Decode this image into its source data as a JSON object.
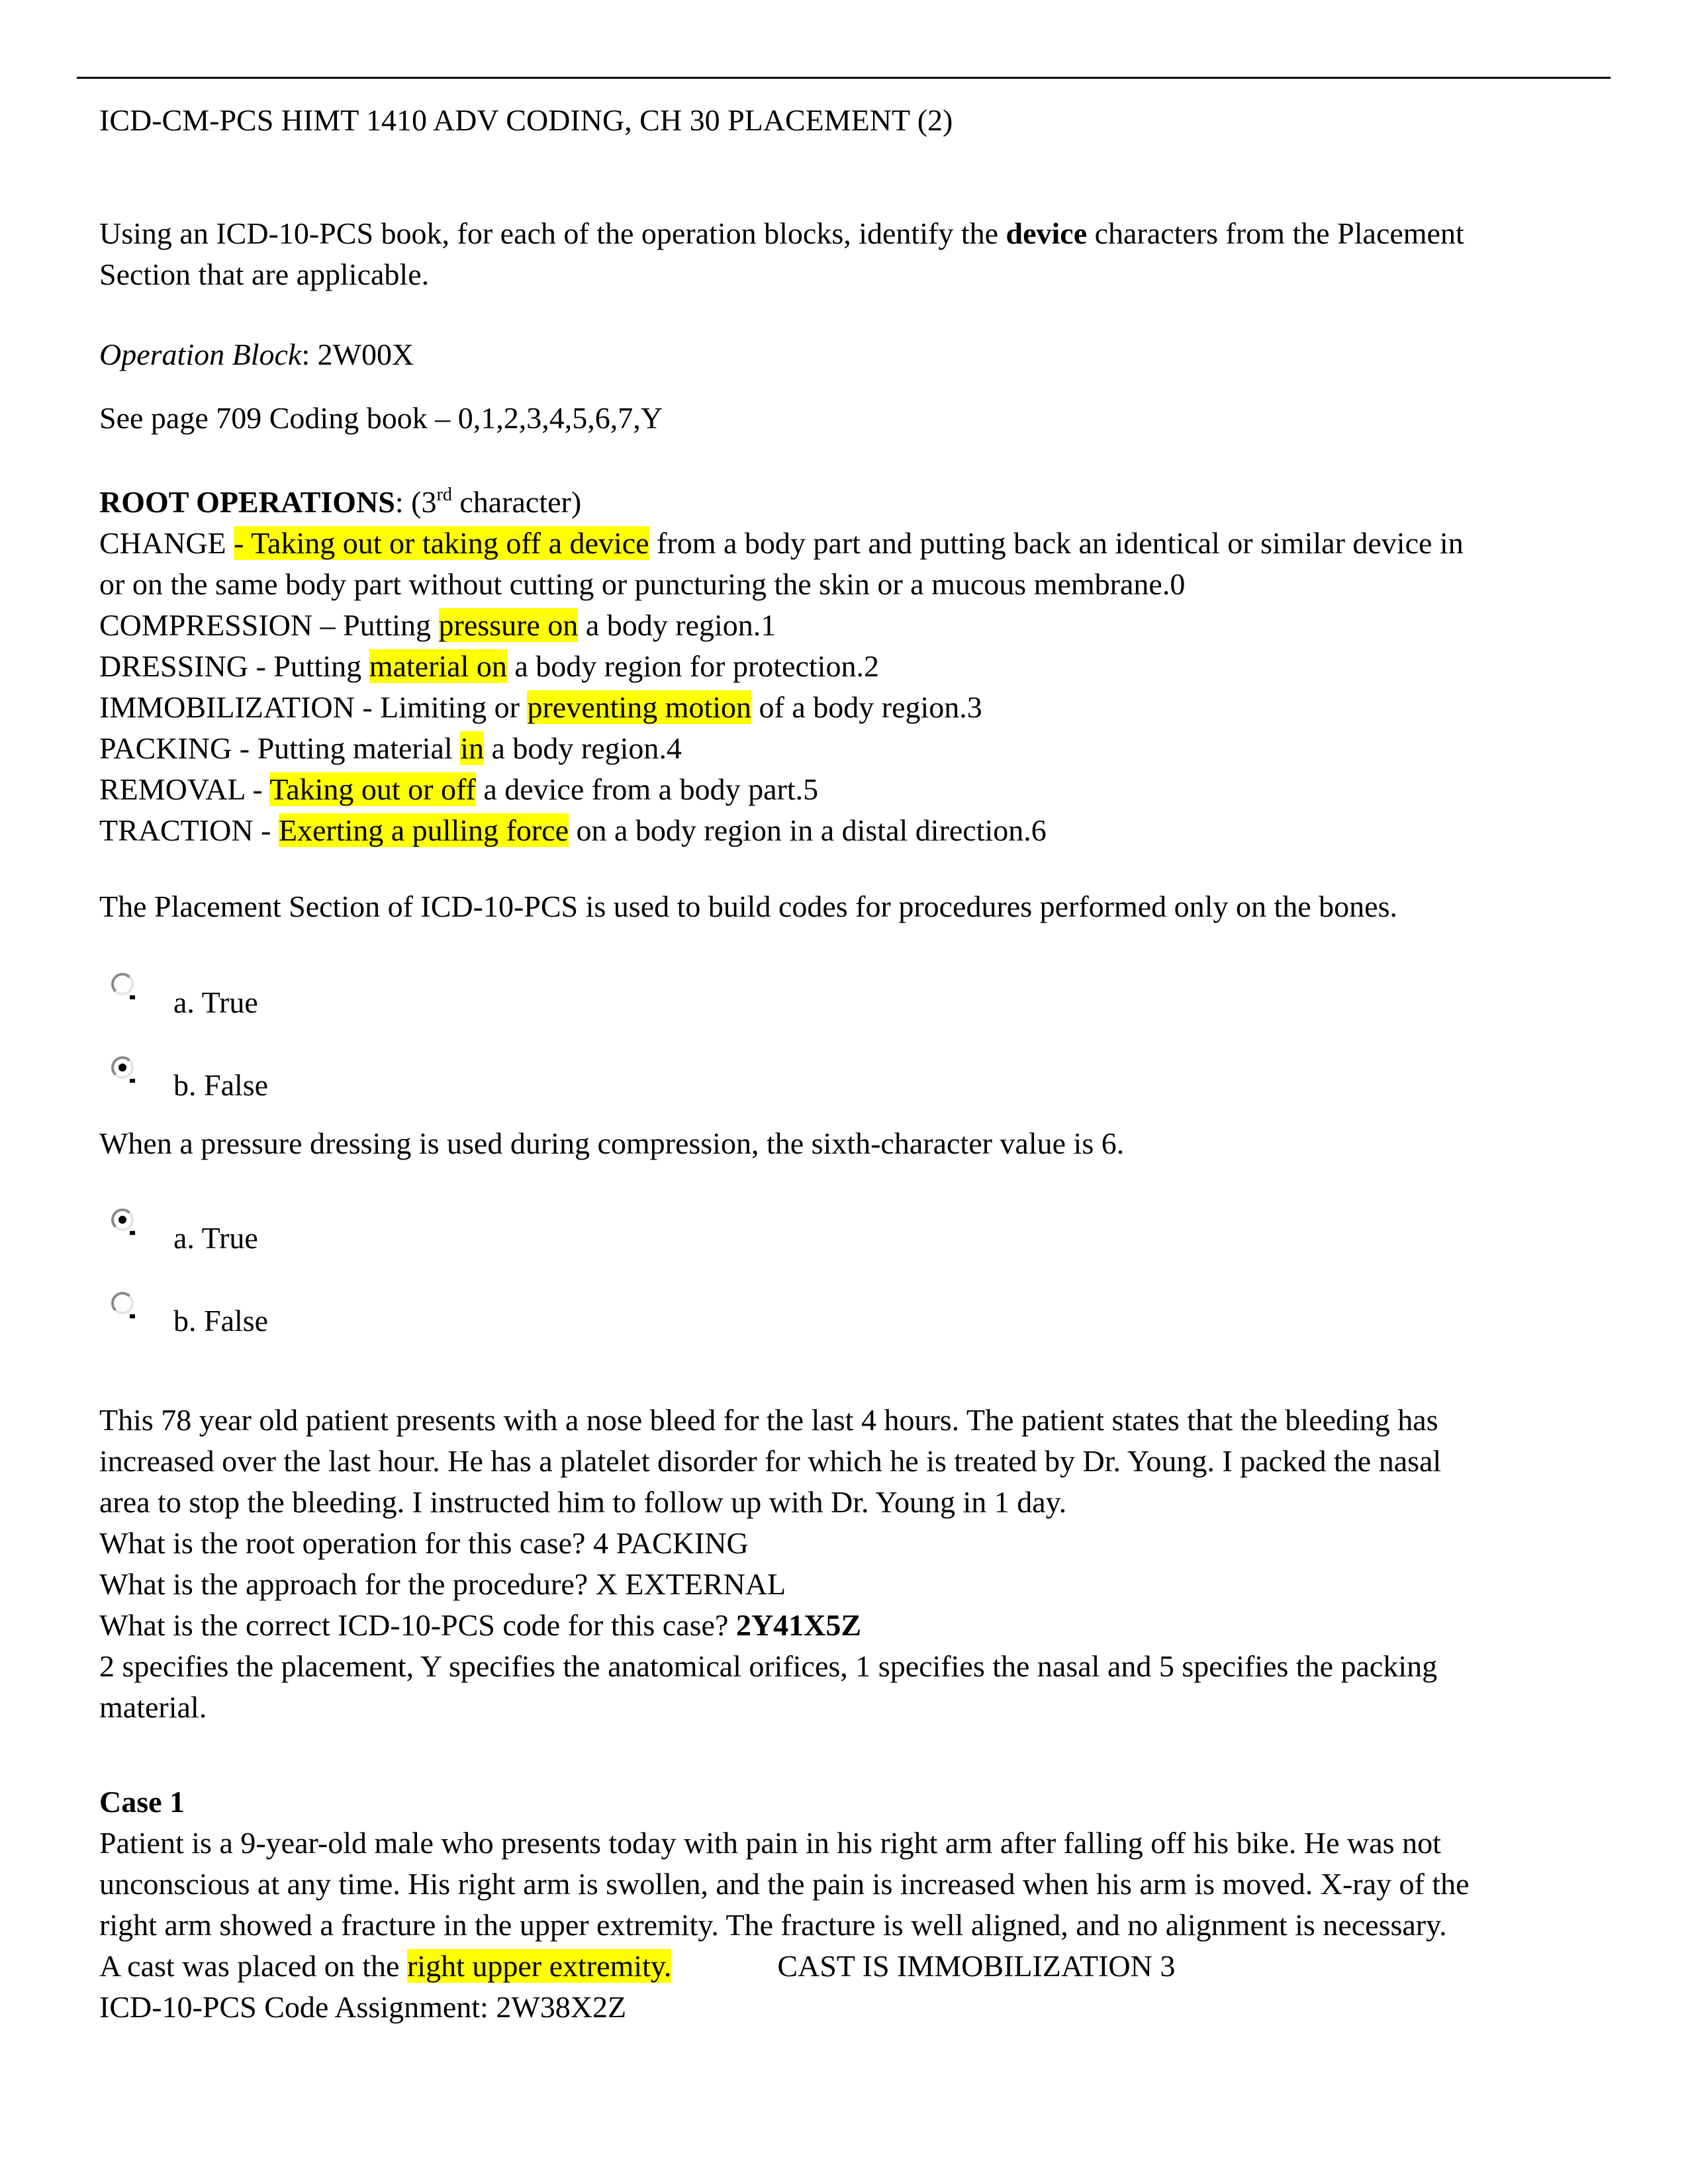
{
  "document": {
    "title": "ICD-CM-PCS HIMT 1410 ADV CODING, CH 30 PLACEMENT (2)",
    "intro": {
      "line1_before": "Using an ICD-10-PCS book, for each of the operation blocks, identify the ",
      "line1_bold": "device",
      "line1_after": " characters from the Placement",
      "line2": "Section that are applicable."
    },
    "operation_block": {
      "label": "Operation Block",
      "value": ": 2W00X"
    },
    "see_page": "See page 709 Coding book – 0,1,2,3,4,5,6,7,Y",
    "root_operations": {
      "heading": "ROOT OPERATIONS",
      "heading_suffix_before": ": (3",
      "heading_sup": "rd",
      "heading_suffix_after": " character)",
      "items": [
        {
          "name": "CHANGE",
          "pre": " ",
          "highlight": "- Taking out or taking off a device",
          "post": " from a body part and putting back an identical or similar device in",
          "cont": "or on the same body part without cutting or puncturing the skin or a mucous membrane.0"
        },
        {
          "name": "COMPRESSION",
          "pre": " – Putting ",
          "highlight": "pressure on",
          "post": " a body region.1"
        },
        {
          "name": "DRESSING",
          "pre": " - Putting ",
          "highlight": "material on",
          "post": " a body region for protection.2"
        },
        {
          "name": "IMMOBILIZATION",
          "pre": " - Limiting or ",
          "highlight": "preventing motion",
          "post": " of a body region.3"
        },
        {
          "name": "PACKING",
          "pre": " - Putting material ",
          "highlight": "in",
          "post": " a body region.4"
        },
        {
          "name": "REMOVAL",
          "pre": " - ",
          "highlight": "Taking out or off",
          "post": " a device from a body part.5"
        },
        {
          "name": "TRACTION",
          "pre": " - ",
          "highlight": "Exerting a pulling force",
          "post": " on a body region in a distal direction.6"
        }
      ]
    },
    "questions": [
      {
        "text": "The Placement Section of ICD-10-PCS is used to build codes for procedures performed only on the bones.",
        "options": [
          {
            "label": "a. True",
            "selected": false
          },
          {
            "label": "b. False",
            "selected": true
          }
        ]
      },
      {
        "text": "When a pressure dressing is used during compression, the sixth-character value is 6.",
        "options": [
          {
            "label": "a. True",
            "selected": true
          },
          {
            "label": "b. False",
            "selected": false
          }
        ]
      }
    ],
    "nosebleed_case": {
      "lines": [
        "This 78 year old patient presents with a nose bleed for the last 4 hours. The patient states that the bleeding has",
        "increased over the last hour. He has a platelet disorder for which he is treated by Dr. Young. I packed the nasal",
        "area to stop the bleeding. I instructed him to follow up with Dr. Young in 1 day."
      ],
      "q_root": "What is the root operation for this case? 4 PACKING",
      "q_approach": "What is the approach for the procedure? X EXTERNAL",
      "q_code_label": "What is the correct ICD-10-PCS code for this case? ",
      "q_code_value": "2Y41X5Z",
      "explanation": [
        "2 specifies the placement, Y specifies the anatomical orifices, 1 specifies the nasal and 5 specifies the packing",
        "material."
      ]
    },
    "case1": {
      "heading": "Case 1",
      "lines": [
        "Patient is a 9-year-old male who presents today with pain in his right arm after falling off his bike. He was not",
        "unconscious at any time. His right arm is swollen, and the pain is increased when his arm is moved. X-ray of the",
        "right arm showed a fracture in the upper extremity. The fracture is well aligned, and no alignment is necessary."
      ],
      "cast_before": "A cast was placed on the ",
      "cast_highlight": "right upper extremity.",
      "cast_note": "CAST IS IMMOBILIZATION 3",
      "code_assignment": "ICD-10-PCS Code Assignment: 2W38X2Z"
    },
    "colors": {
      "highlight": "#ffff00",
      "text": "#000000",
      "rule": "#000000"
    }
  }
}
